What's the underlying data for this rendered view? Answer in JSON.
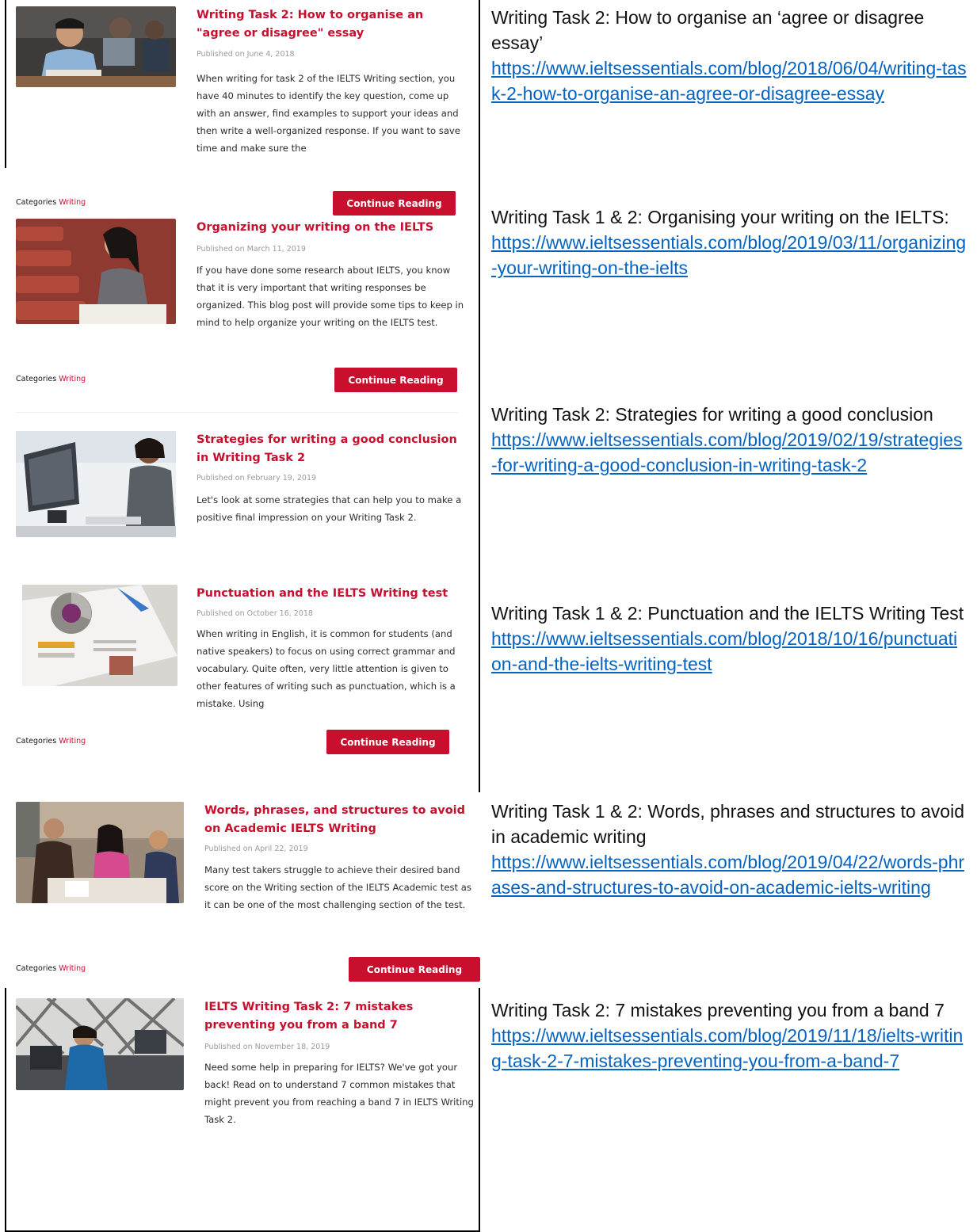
{
  "category_label": "Categories",
  "category_value": "Writing",
  "button_label": "Continue Reading",
  "accent_color": "#c8102e",
  "link_color": "#0563c1",
  "posts": [
    {
      "title": "Writing Task 2: How to organise an \"agree or disagree\" essay",
      "date": "Published on June 4, 2018",
      "excerpt": "When writing for task 2 of the IELTS Writing section, you have 40 minutes to identify the key question, come up with an answer, find examples to support your ideas and then write a well-organized response. If you want to save time and make sure the",
      "doc_title": "Writing Task 2: How to organise an ‘agree or disagree essay’",
      "url": "https://www.ieltsessentials.com/blog/2018/06/04/writing-task-2-how-to-organise-an-agree-or-disagree-essay"
    },
    {
      "title": "Organizing your writing on the IELTS",
      "date": "Published on March 11, 2019",
      "excerpt": "If you have done some research about IELTS, you know that it is very important that writing responses be organized. This blog post will provide some tips to keep in mind to help organize your writing on the IELTS test.",
      "doc_title": "Writing Task 1 & 2: Organising your writing on the IELTS:",
      "url": "https://www.ieltsessentials.com/blog/2019/03/11/organizing-your-writing-on-the-ielts"
    },
    {
      "title": "Strategies for writing a good conclusion in Writing Task 2",
      "date": "Published on February 19, 2019",
      "excerpt": "Let's look at some strategies that can help you to make a positive final impression on your Writing Task 2.",
      "doc_title": "Writing Task 2: Strategies for writing a good conclusion",
      "url": "https://www.ieltsessentials.com/blog/2019/02/19/strategies-for-writing-a-good-conclusion-in-writing-task-2"
    },
    {
      "title": "Punctuation and the IELTS Writing test",
      "date": "Published on October 16, 2018",
      "excerpt": "When writing in English, it is common for students (and native speakers) to focus on using correct grammar and vocabulary. Quite often, very little attention is given to other features of writing such as punctuation, which is a mistake. Using",
      "doc_title": "Writing Task 1 & 2: Punctuation and the IELTS Writing Test",
      "url": "https://www.ieltsessentials.com/blog/2018/10/16/punctuation-and-the-ielts-writing-test"
    },
    {
      "title": "Words, phrases, and structures to avoid on Academic IELTS Writing",
      "date": "Published on April 22, 2019",
      "excerpt": "Many test takers struggle to achieve their desired band score on the Writing section of the IELTS Academic test as it can be one of the most challenging section of the test.",
      "doc_title": "Writing Task 1 & 2: Words, phrases and structures to avoid in academic writing",
      "url": "https://www.ieltsessentials.com/blog/2019/04/22/words-phrases-and-structures-to-avoid-on-academic-ielts-writing"
    },
    {
      "title": "IELTS Writing Task 2: 7 mistakes preventing you from a band 7",
      "date": "Published on November 18, 2019",
      "excerpt": "Need some help in preparing for IELTS? We've got your back! Read on to understand 7 common mistakes that might prevent you from reaching a band 7 in IELTS Writing Task 2.",
      "doc_title": "Writing Task 2: 7 mistakes preventing you from a band 7",
      "url": "https://www.ieltsessentials.com/blog/2019/11/18/ielts-writing-task-2-7-mistakes-preventing-you-from-a-band-7"
    }
  ]
}
